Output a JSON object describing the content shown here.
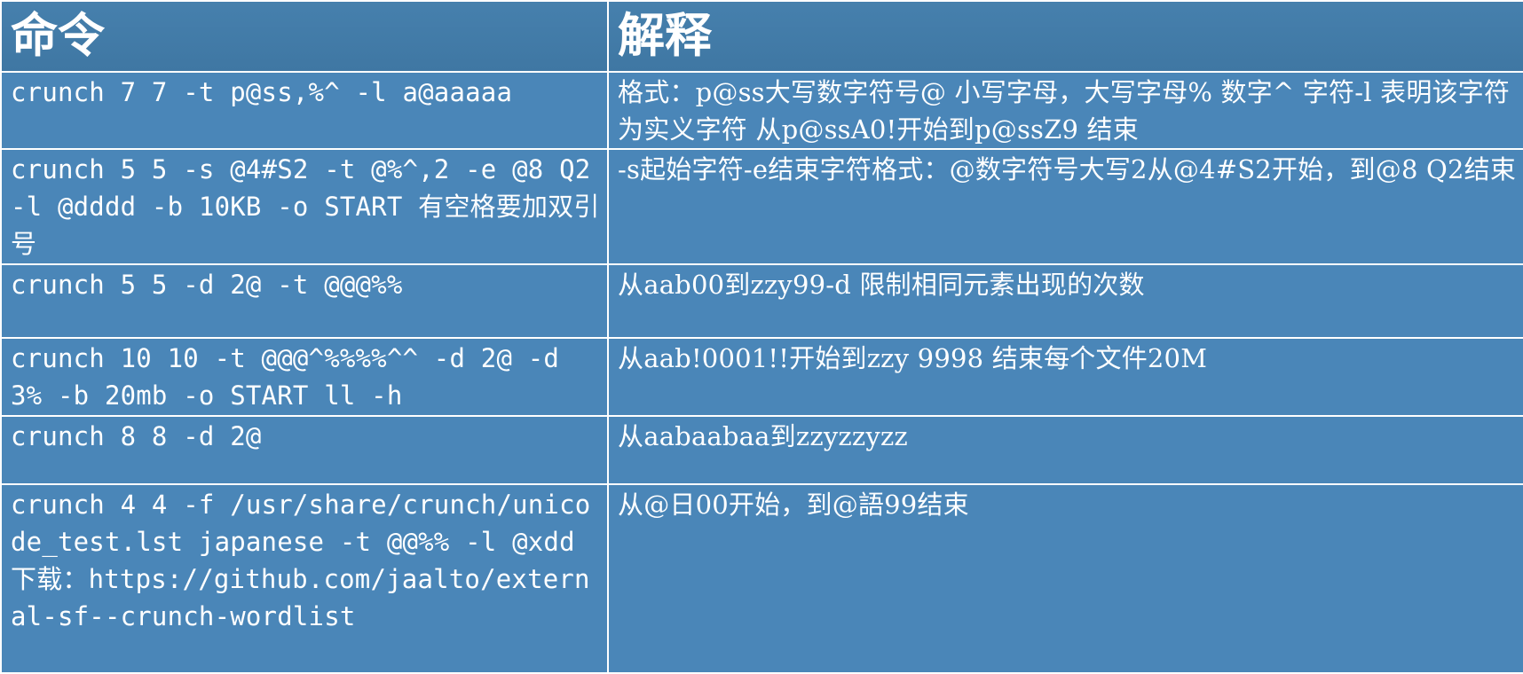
{
  "table": {
    "headers": [
      "命令",
      "解释"
    ],
    "rows": [
      {
        "command": "crunch 7 7 -t p@ss,%^ -l a@aaaaa",
        "explanation": "格式：p@ss大写数字符号@ 小写字母，大写字母% 数字^ 字符-l 表明该字符为实义字符 从p@ssA0!开始到p@ssZ9 结束"
      },
      {
        "command": "crunch 5 5 -s @4#S2 -t @%^,2 -e @8 Q2 -l @dddd -b 10KB -o START 有空格要加双引号",
        "explanation": "-s起始字符-e结束字符格式：@数字符号大写2从@4#S2开始，到@8 Q2结束"
      },
      {
        "command": "crunch 5 5 -d 2@ -t @@@%%",
        "explanation": "从aab00到zzy99-d 限制相同元素出现的次数"
      },
      {
        "command": "crunch 10 10 -t @@@^%%%%^^ -d 2@ -d 3% -b 20mb -o START ll -h",
        "explanation": "从aab!0001!!开始到zzy 9998  结束每个文件20M"
      },
      {
        "command": "crunch 8 8 -d 2@",
        "explanation": "从aabaabaa到zzyzzyzz"
      },
      {
        "command": "crunch 4 4 -f /usr/share/crunch/unicode_test.lst japanese -t @@%% -l @xdd 下载：https://github.com/jaalto/external-sf--crunch-wordlist",
        "explanation": "从@日00开始，到@語99结束"
      }
    ]
  }
}
